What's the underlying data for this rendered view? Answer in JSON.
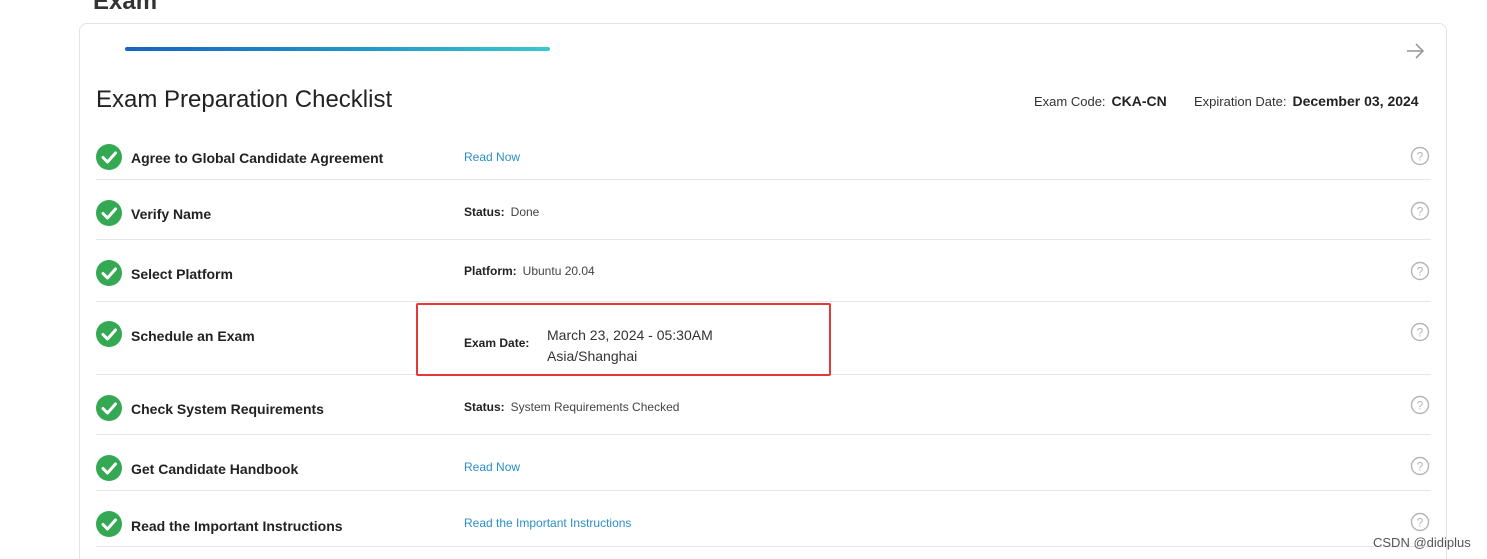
{
  "page": {
    "heading": "Exam"
  },
  "header": {
    "title": "Exam Preparation Checklist",
    "exam_code_label": "Exam Code:",
    "exam_code_value": "CKA-CN",
    "expiration_label": "Expiration Date:",
    "expiration_value": "December 03, 2024"
  },
  "progress": {
    "fraction": 1.0
  },
  "checklist": [
    {
      "label": "Agree to Global Candidate Agreement",
      "link": "Read Now"
    },
    {
      "label": "Verify Name",
      "status_key": "Status:",
      "status_value": "Done"
    },
    {
      "label": "Select Platform",
      "status_key": "Platform:",
      "status_value": "Ubuntu 20.04"
    },
    {
      "label": "Schedule an Exam",
      "status_key": "Exam Date:",
      "status_value_line1": "March 23, 2024 - 05:30AM",
      "status_value_line2": "Asia/Shanghai"
    },
    {
      "label": "Check System Requirements",
      "status_key": "Status:",
      "status_value": "System Requirements Checked"
    },
    {
      "label": "Get Candidate Handbook",
      "link": "Read Now"
    },
    {
      "label": "Read the Important Instructions",
      "link": "Read the Important Instructions"
    }
  ],
  "colors": {
    "check": "#34a853",
    "link": "#2a8fc9",
    "highlight": "#e53935",
    "help": "#b5b5b5"
  },
  "icons": {
    "next": "arrow-right-icon",
    "done": "check-circle-icon",
    "help": "question-circle-icon"
  },
  "watermark": "CSDN @didiplus"
}
